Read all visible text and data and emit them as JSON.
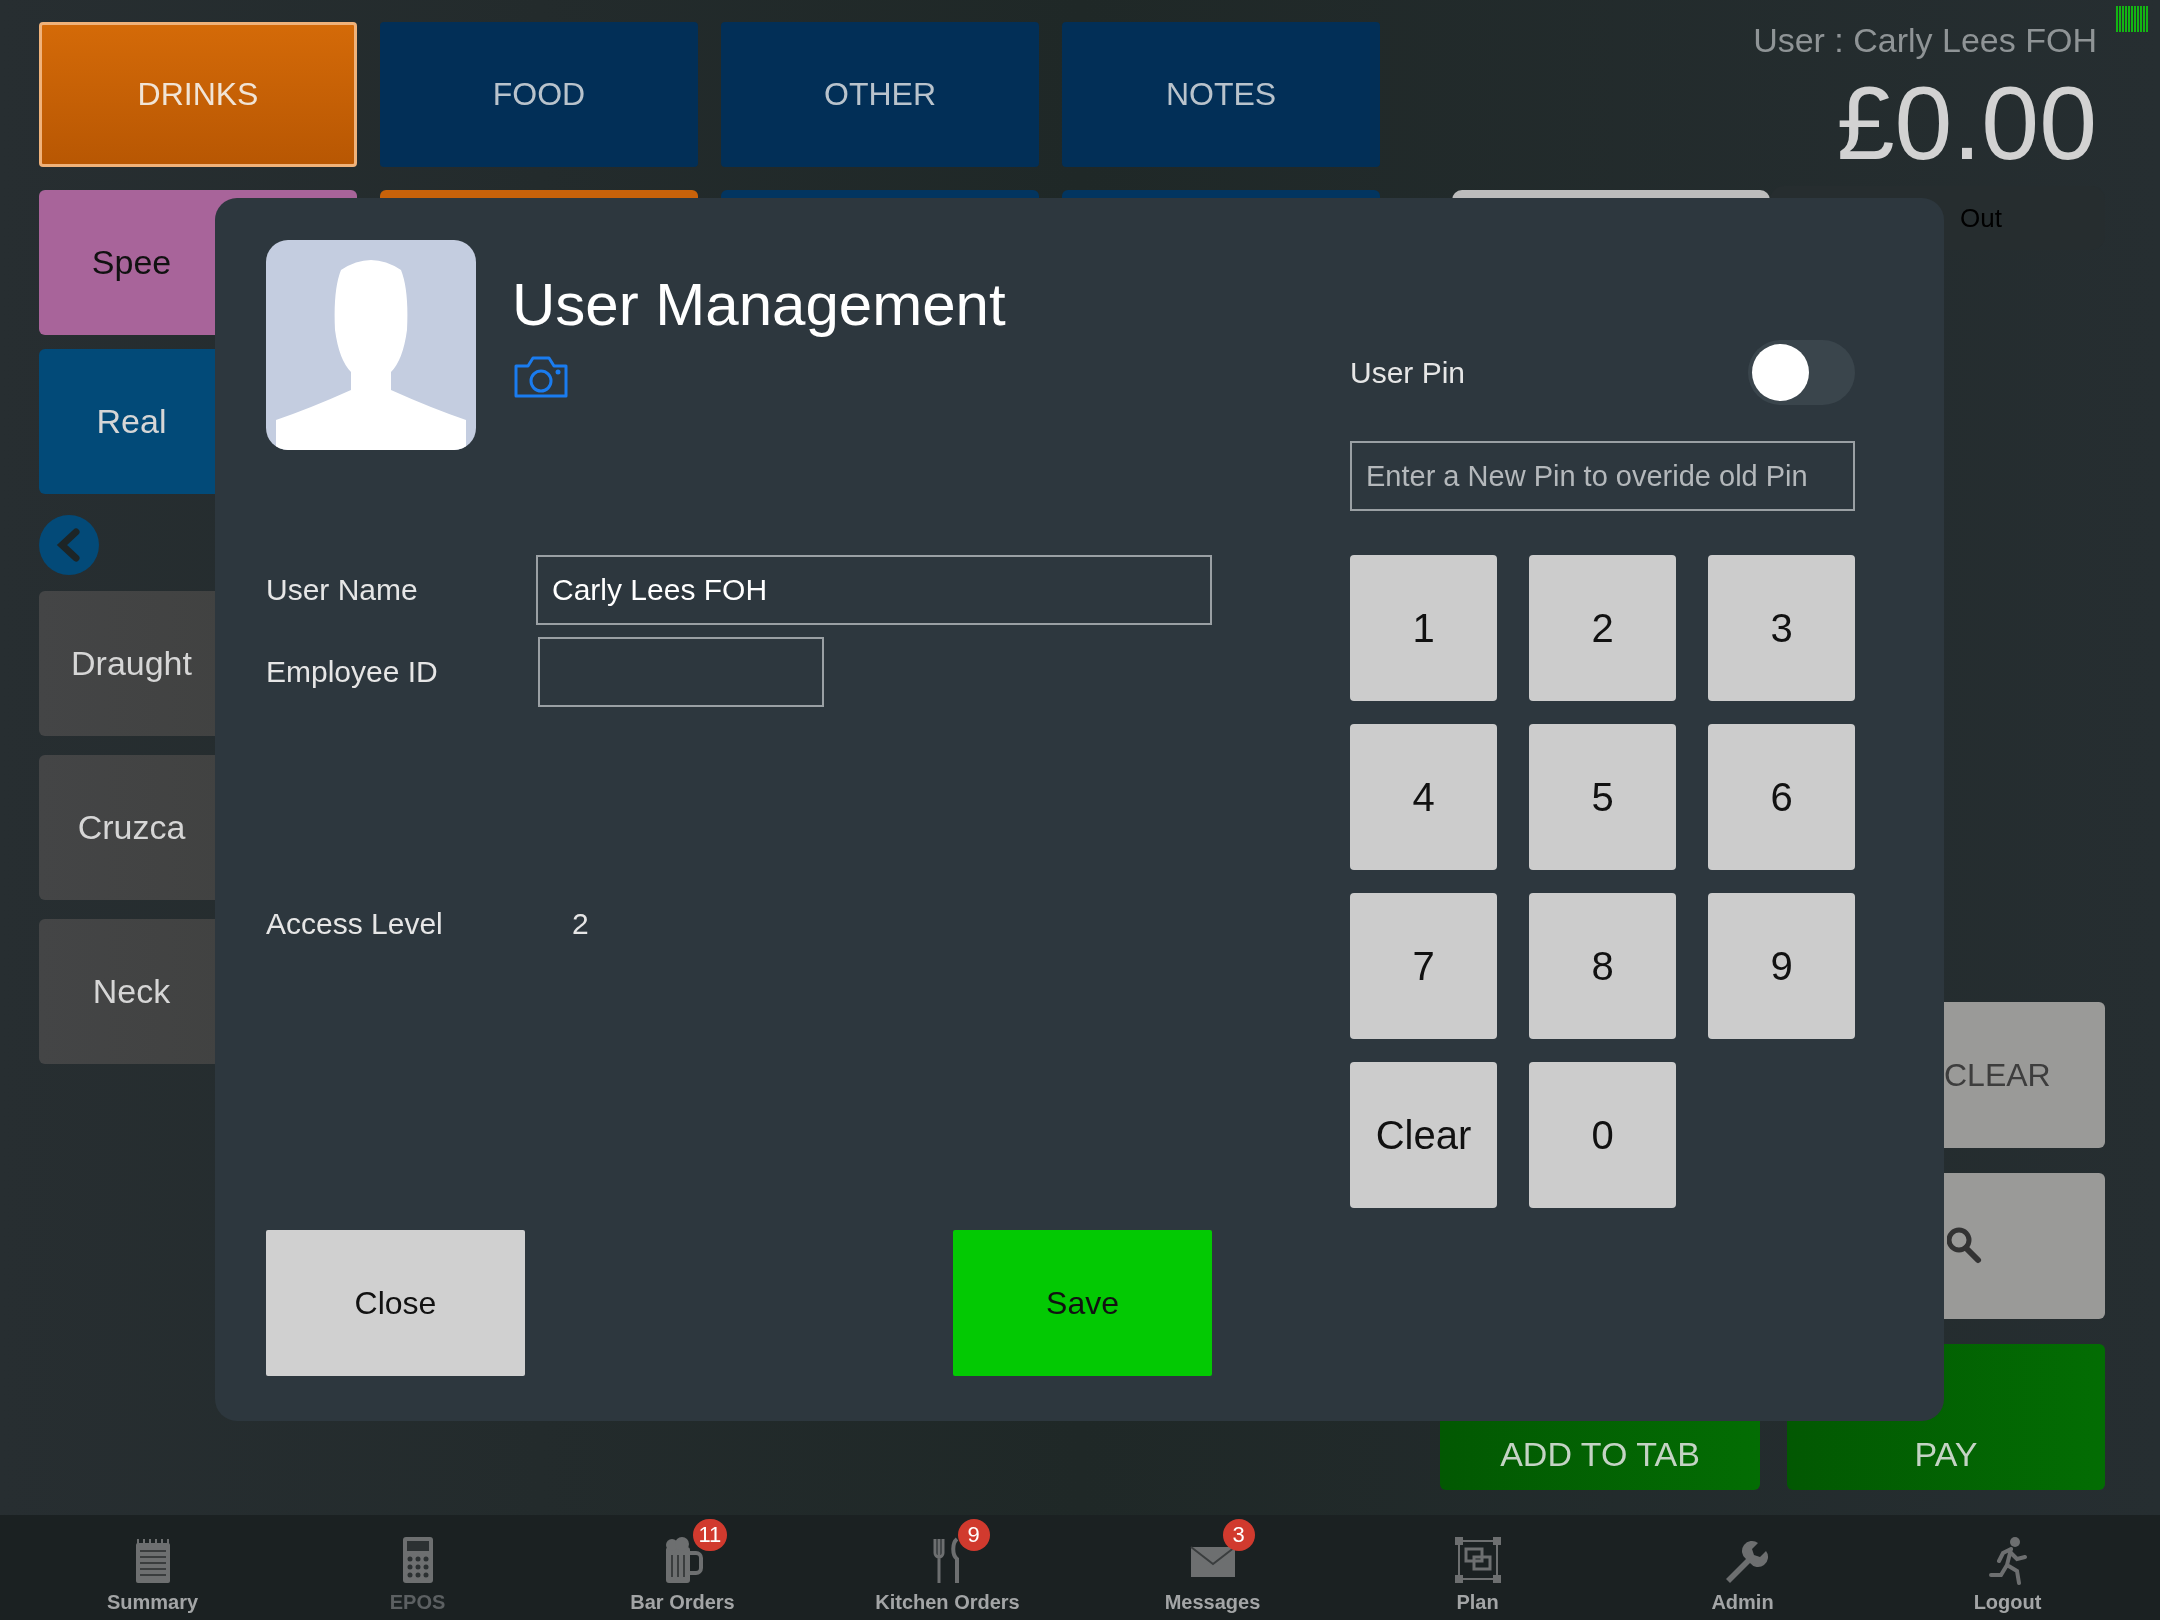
{
  "top_tabs": [
    {
      "label": "DRINKS",
      "selected": true
    },
    {
      "label": "FOOD",
      "selected": false
    },
    {
      "label": "OTHER",
      "selected": false
    },
    {
      "label": "NOTES",
      "selected": false
    }
  ],
  "category_tiles": [
    {
      "label": "Spee",
      "color": "#a8649a"
    },
    {
      "color": "#c8620a"
    },
    {
      "color": "#023560"
    },
    {
      "color": "#023560"
    }
  ],
  "feature_tile": {
    "label": "Real",
    "color": "#024a78"
  },
  "subcategory_tiles": [
    {
      "label": "Draught"
    },
    {
      "label": "Cruzca"
    },
    {
      "label": "Neck"
    }
  ],
  "header": {
    "user": "User : Carly Lees FOH",
    "total": "£0.00",
    "order_type": "Out"
  },
  "actions": [
    {
      "kind": "clear",
      "label": "CLEAR"
    },
    {
      "kind": "search"
    }
  ],
  "bottom_actions": [
    {
      "label": "ADD TO TAB"
    },
    {
      "label": "PAY"
    }
  ],
  "dialog": {
    "title": "User Management",
    "pin": {
      "label": "User Pin",
      "on": false,
      "placeholder": "Enter a New Pin to overide old Pin"
    },
    "fields": [
      {
        "label": "User Name",
        "value": "Carly Lees FOH"
      },
      {
        "label": "Employee ID"
      }
    ],
    "access": {
      "label": "Access Level",
      "value": "2"
    },
    "keypad": [
      "1",
      "2",
      "3",
      "4",
      "5",
      "6",
      "7",
      "8",
      "9",
      "Clear",
      "0"
    ],
    "close": "Close",
    "save": "Save"
  },
  "nav": [
    {
      "label": "Summary",
      "selected": false
    },
    {
      "label": "EPOS",
      "selected": true
    },
    {
      "label": "Bar Orders",
      "selected": false,
      "badge": "11"
    },
    {
      "label": "Kitchen Orders",
      "selected": false,
      "badge": "9"
    },
    {
      "label": "Messages",
      "selected": false,
      "badge": "3"
    },
    {
      "label": "Plan",
      "selected": false
    },
    {
      "label": "Admin",
      "selected": false
    },
    {
      "label": "Logout",
      "selected": false
    }
  ]
}
